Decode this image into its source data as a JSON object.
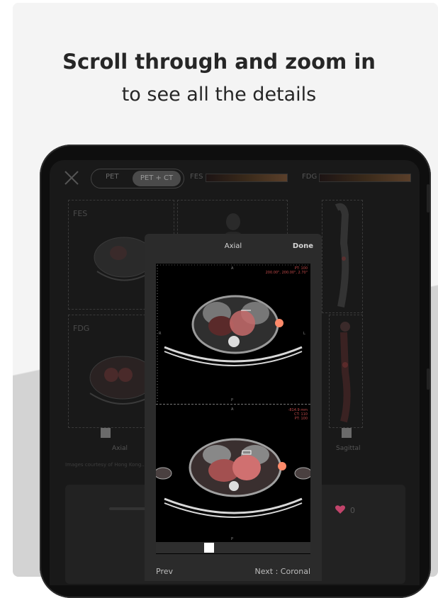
{
  "headline": "Scroll through and zoom in",
  "subline": "to see all the details",
  "toolbar": {
    "toggle_options": [
      "PET",
      "PET + CT"
    ],
    "tracer_1": "FES",
    "tracer_2": "FDG"
  },
  "panels": {
    "fes_label": "FES",
    "fdg_label": "FDG",
    "axial_label": "Axial",
    "sagittal_label": "Sagittal",
    "credit": "Images courtesy of Hong Kong..."
  },
  "like": {
    "count": "0"
  },
  "modal": {
    "title": "Axial",
    "done_label": "Done",
    "top_info": [
      "PT: 100",
      "200.00\", 200.00\", 2.70\""
    ],
    "bottom_info": [
      "-814.9 mm",
      "CT: 110",
      "PT: 100"
    ],
    "axis_labels": {
      "top": "A",
      "bottom": "P",
      "left": "R",
      "right": "L"
    },
    "prev_label": "Prev",
    "next_label": "Next : Coronal"
  },
  "colors": {
    "card_bg": "#f2f2f2",
    "tablet_bezel": "#0e0e0e",
    "screen_bg": "#191919",
    "modal_bg": "#2b2b2b",
    "heart": "#c2446b"
  }
}
